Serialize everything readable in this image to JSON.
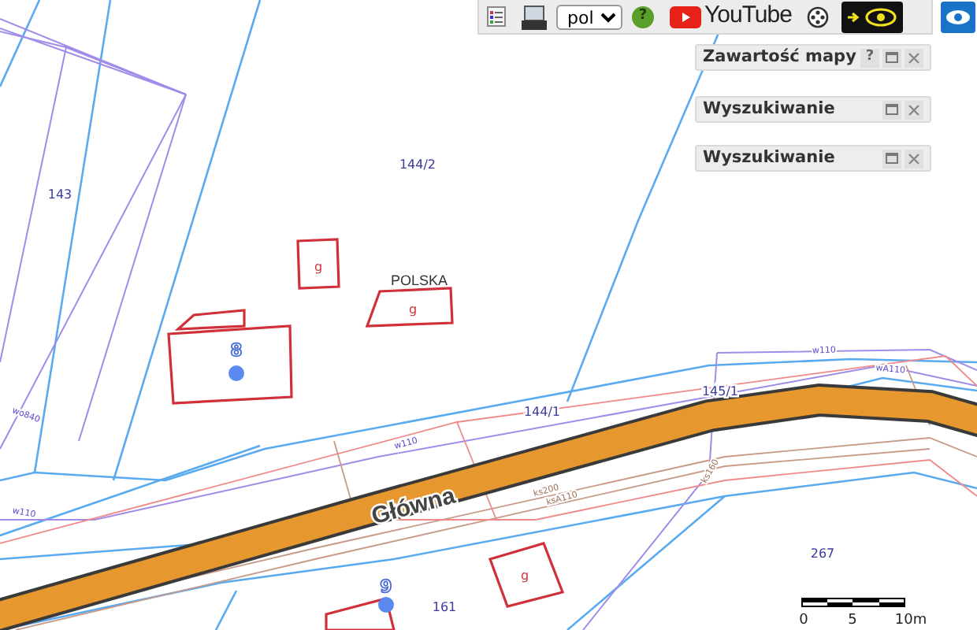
{
  "toolbar": {
    "language": "pol",
    "help": "?",
    "youtube": "YouTube"
  },
  "panels": [
    {
      "title": "Zawartość mapy",
      "help": "?"
    },
    {
      "title": "Wyszukiwanie"
    },
    {
      "title": "Wyszukiwanie"
    }
  ],
  "map": {
    "road_name": "Główna",
    "place_name": "POLSKA",
    "parcels": [
      "144/2",
      "143",
      "144/1",
      "145/1",
      "267",
      "161"
    ],
    "buildings": [
      "g",
      "g",
      "g"
    ],
    "addresses": [
      "8",
      "9"
    ],
    "utility_labels": [
      "w110",
      "w110",
      "w110",
      "wA110",
      "ks200",
      "ksA110",
      "ks160",
      "wo840"
    ]
  },
  "scale": {
    "labels": [
      "0",
      "5",
      "10m"
    ]
  }
}
